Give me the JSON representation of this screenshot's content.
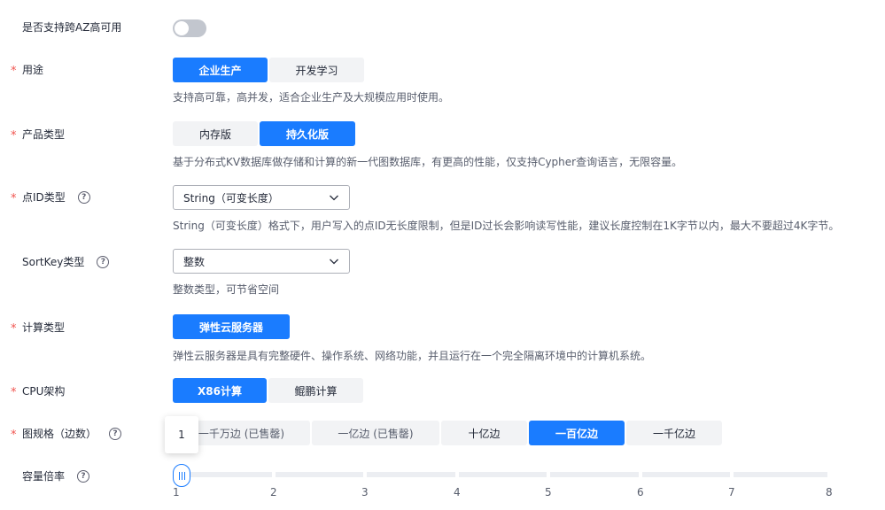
{
  "cross_az": {
    "label": "是否支持跨AZ高可用",
    "enabled": false
  },
  "usage": {
    "label": "用途",
    "options": [
      "企业生产",
      "开发学习"
    ],
    "selected": "企业生产",
    "description": "支持高可靠，高并发，适合企业生产及大规模应用时使用。"
  },
  "product_type": {
    "label": "产品类型",
    "options": [
      "内存版",
      "持久化版"
    ],
    "selected": "持久化版",
    "description": "基于分布式KV数据库做存储和计算的新一代图数据库，有更高的性能，仅支持Cypher查询语言，无限容量。"
  },
  "vertex_id_type": {
    "label": "点ID类型",
    "value": "String（可变长度）",
    "description": "String（可变长度）格式下，用户写入的点ID无长度限制，但是ID过长会影响读写性能，建议长度控制在1K字节以内，最大不要超过4K字节。"
  },
  "sortkey_type": {
    "label": "SortKey类型",
    "value": "整数",
    "description": "整数类型，可节省空间"
  },
  "compute_type": {
    "label": "计算类型",
    "options": [
      "弹性云服务器"
    ],
    "selected": "弹性云服务器",
    "description": "弹性云服务器是具有完整硬件、操作系统、网络功能，并且运行在一个完全隔离环境中的计算机系统。"
  },
  "cpu_arch": {
    "label": "CPU架构",
    "options": [
      "X86计算",
      "鲲鹏计算"
    ],
    "selected": "X86计算"
  },
  "graph_spec": {
    "label": "图规格（边数）",
    "options": [
      "一千万边 (已售罄)",
      "一亿边 (已售罄)",
      "十亿边",
      "一百亿边",
      "一千亿边"
    ],
    "selected": "一百亿边"
  },
  "capacity_ratio": {
    "label": "容量倍率",
    "value": 1,
    "tooltip": "1",
    "ticks": [
      "1",
      "2",
      "3",
      "4",
      "5",
      "6",
      "7",
      "8"
    ]
  },
  "colors": {
    "accent": "#1a7cff",
    "required": "#f0544f",
    "toggle_off": "#c2c6ce"
  }
}
